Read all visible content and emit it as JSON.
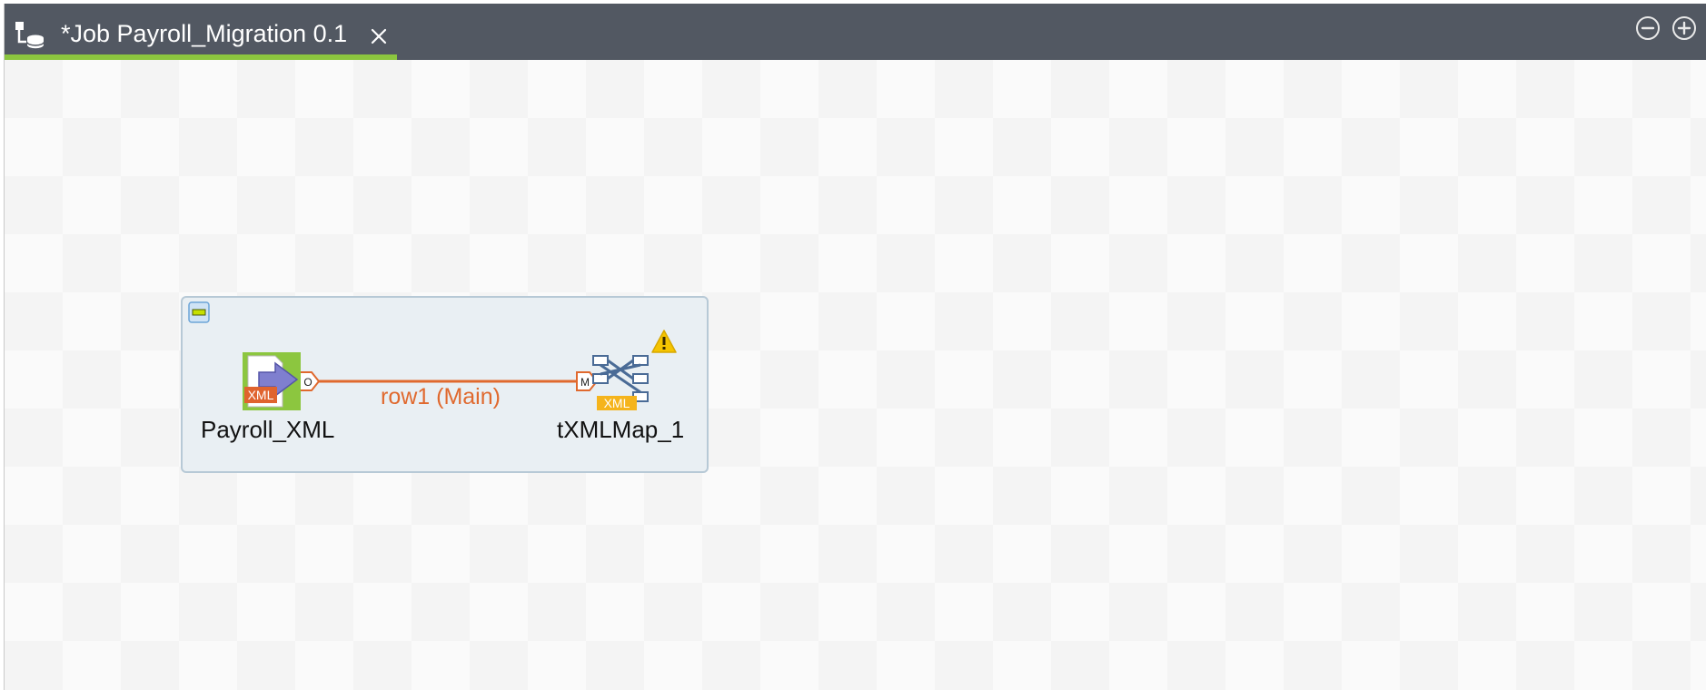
{
  "editor": {
    "tab": {
      "title": "*Job Payroll_Migration 0.1",
      "icon": "job-designer-icon",
      "close_icon": "close-icon",
      "active_underline_color": "#8cc63f"
    },
    "window_controls": {
      "minimize_icon": "minimize-icon",
      "maximize_icon": "maximize-icon"
    },
    "tabbar_color": "#525862"
  },
  "job_canvas": {
    "subjob": {
      "collapse_icon": "collapse-icon",
      "warning_icon": "warning-icon",
      "components": [
        {
          "name": "Payroll_XML",
          "icon": "xml-input-icon",
          "icon_text": "XML",
          "port_label": "O"
        },
        {
          "name": "tXMLMap_1",
          "icon": "xml-map-icon",
          "icon_text": "XML",
          "port_label": "M"
        }
      ],
      "connection": {
        "label": "row1 (Main)",
        "color": "#e0692e"
      }
    }
  }
}
